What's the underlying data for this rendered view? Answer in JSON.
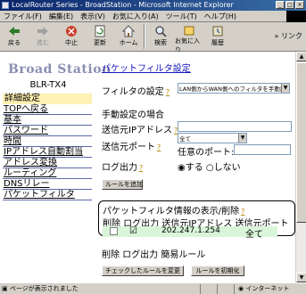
{
  "window": {
    "title": "LocalRouter Series - BroadStation - Microsoft Internet Explorer",
    "controls": [
      "_",
      "□",
      "×"
    ]
  },
  "menu": [
    "ファイル(F)",
    "編集(E)",
    "表示(V)",
    "お気に入り(A)",
    "ツール(T)",
    "ヘルプ(H)"
  ],
  "toolbar": {
    "back": "戻る",
    "forward": "進む",
    "stop": "中止",
    "refresh": "更新",
    "home": "ホーム",
    "search": "検索",
    "favorites": "お気に入り",
    "history": "履歴",
    "links": "リンク"
  },
  "sidebar": {
    "brand": "Broad Station",
    "model": "BLR-TX4",
    "detail_heading": "詳細設定",
    "items": [
      {
        "label": "TOPへ戻る"
      },
      {
        "label": "基本"
      },
      {
        "label": "パスワード"
      },
      {
        "label": "時間"
      },
      {
        "label": "IPアドレス自動割当"
      },
      {
        "label": "アドレス変換"
      },
      {
        "label": "ルーティング"
      },
      {
        "label": "DNSリレー"
      },
      {
        "label": "パケットフィルタ"
      }
    ]
  },
  "main": {
    "title": "パケットフィルタ設定",
    "help_mark": "?",
    "filter_label": "フィルタの設定",
    "filter_select": "LAN側からWAN側へのフィルタを手動設定",
    "manual_heading": "手動設定の場合",
    "src_ip_label": "送信元IPアドレス",
    "src_ip_value": "",
    "src_port_label": "送信元ポート",
    "src_port_select": "全て",
    "any_port_label": "任意のポート:",
    "any_port_value": "",
    "log_label": "ログ出力",
    "log_on": "する",
    "log_off": "しない",
    "add_rule_button": "ルールを追加",
    "rules_heading": "パケットフィルタ情報の表示/削除",
    "rules_columns": "削除 ログ出力 送信元IPアドレス 送信元ポート",
    "rule_row": {
      "delete": "",
      "log": "☑",
      "src_ip": "202.247.1.254",
      "src_port": "全て"
    },
    "simple_rules_heading": "削除 ログ出力 簡易ルール",
    "change_checked_button": "チェックしたルールを変更",
    "reset_rules_button": "ルールを初期化"
  },
  "status": {
    "text": "ページが表示されました",
    "zone": "インターネット"
  }
}
